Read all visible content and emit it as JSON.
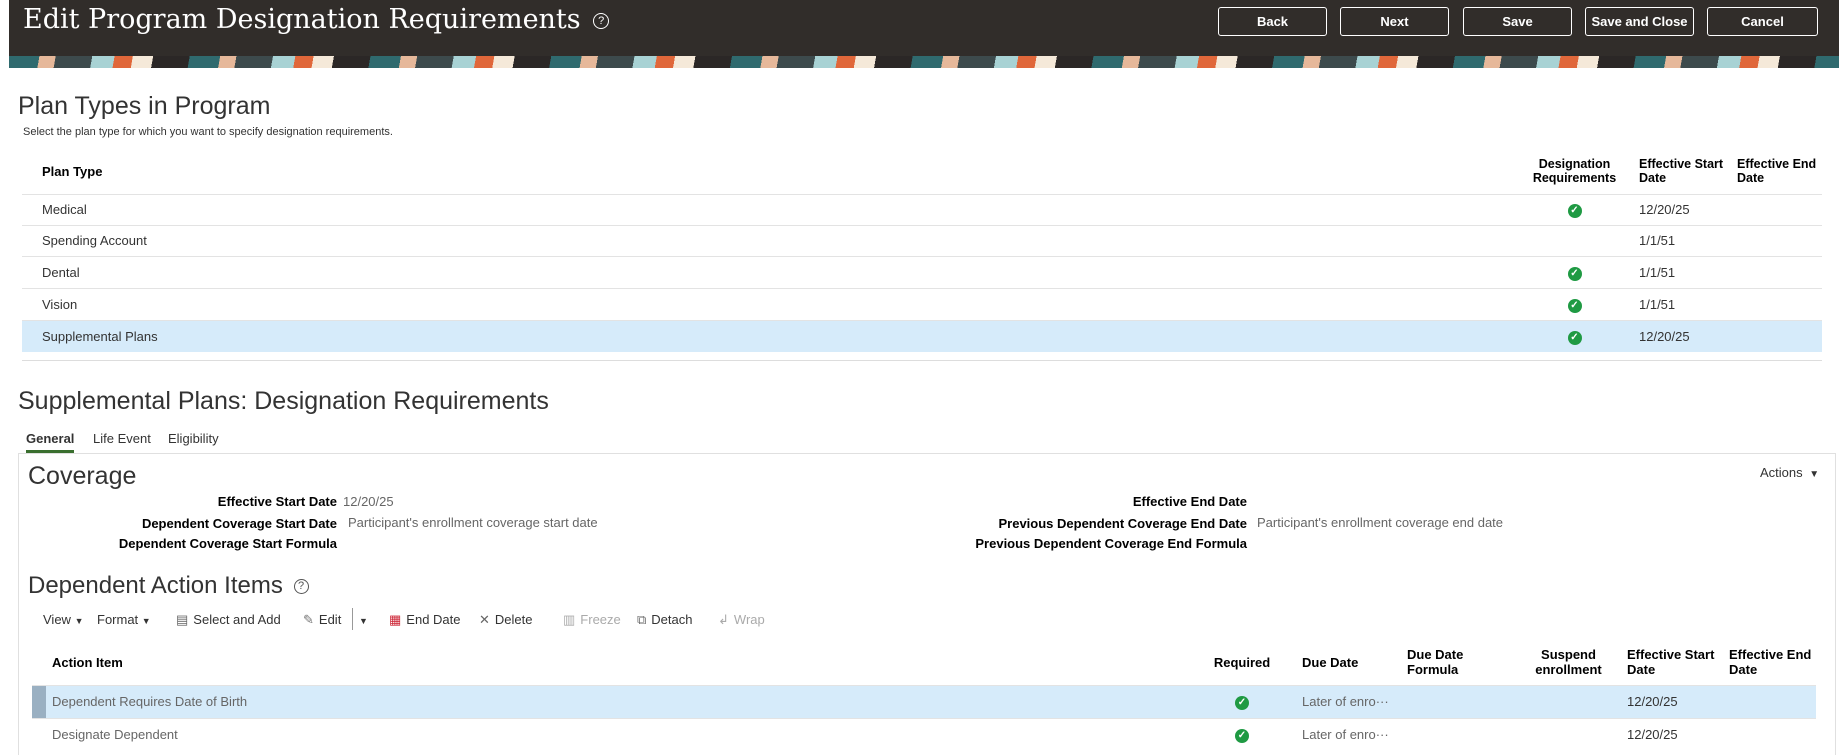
{
  "header": {
    "title": "Edit Program Designation Requirements",
    "help": "?",
    "buttons": {
      "back": "Back",
      "next": "Next",
      "save": "Save",
      "save_close": "Save and Close",
      "cancel": "Cancel"
    }
  },
  "plan_types": {
    "title": "Plan Types in Program",
    "instruction": "Select the plan type for which you want to specify designation requirements.",
    "columns": {
      "plan_type": "Plan Type",
      "designation": "Designation Requirements",
      "start": "Effective Start Date",
      "end": "Effective End Date"
    },
    "rows": [
      {
        "plan": "Medical",
        "designation": true,
        "start": "12/20/25",
        "end": ""
      },
      {
        "plan": "Spending Account",
        "designation": false,
        "start": "1/1/51",
        "end": ""
      },
      {
        "plan": "Dental",
        "designation": true,
        "start": "1/1/51",
        "end": ""
      },
      {
        "plan": "Vision",
        "designation": true,
        "start": "1/1/51",
        "end": ""
      },
      {
        "plan": "Supplemental Plans",
        "designation": true,
        "start": "12/20/25",
        "end": "",
        "selected": true
      }
    ]
  },
  "detail": {
    "title": "Supplemental Plans: Designation Requirements",
    "tabs": [
      "General",
      "Life Event",
      "Eligibility"
    ],
    "coverage": {
      "title": "Coverage",
      "actions": "Actions",
      "eff_start_label": "Effective Start Date",
      "eff_start_value": "12/20/25",
      "dep_start_label": "Dependent Coverage Start Date",
      "dep_start_value": "Participant's enrollment coverage start date",
      "dep_formula_label": "Dependent Coverage Start Formula",
      "eff_end_label": "Effective End Date",
      "prev_end_label": "Previous Dependent Coverage End Date",
      "prev_end_value": "Participant's enrollment coverage end date",
      "prev_formula_label": "Previous Dependent Coverage End Formula"
    },
    "action_items": {
      "title": "Dependent Action Items",
      "toolbar": {
        "view": "View",
        "format": "Format",
        "select_add": "Select and Add",
        "edit": "Edit",
        "end_date": "End Date",
        "delete": "Delete",
        "freeze": "Freeze",
        "detach": "Detach",
        "wrap": "Wrap"
      },
      "columns": {
        "action_item": "Action Item",
        "required": "Required",
        "due_date": "Due Date",
        "due_formula": "Due Date Formula",
        "suspend": "Suspend enrollment",
        "start": "Effective Start Date",
        "end": "Effective End Date"
      },
      "rows": [
        {
          "item": "Dependent Requires Date of Birth",
          "required": true,
          "due": "Later of enro···",
          "formula": "",
          "suspend": "",
          "start": "12/20/25",
          "end": "",
          "selected": true
        },
        {
          "item": "Designate Dependent",
          "required": true,
          "due": "Later of enro···",
          "formula": "",
          "suspend": "",
          "start": "12/20/25",
          "end": ""
        }
      ]
    }
  }
}
